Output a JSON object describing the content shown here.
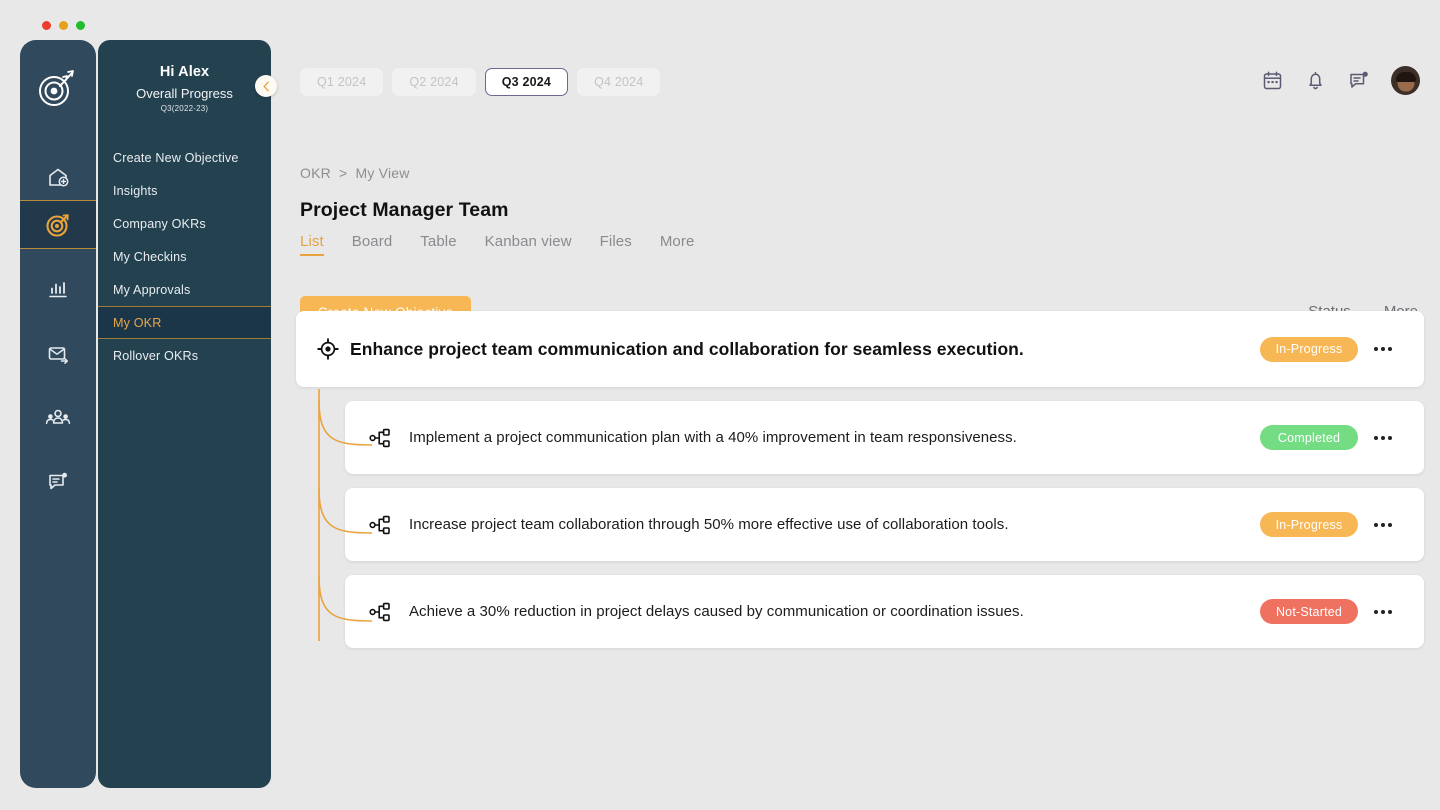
{
  "window": {
    "controls": [
      "close",
      "minimize",
      "maximize"
    ]
  },
  "colors": {
    "rail_bg": "#30495c",
    "nav_bg": "#23414f",
    "accent_orange": "#e8a33d",
    "button_orange": "#f7b755",
    "status_in_progress": "#f7b755",
    "status_completed": "#74dd84",
    "status_not_started": "#ef7261",
    "page_bg": "#e8e8e8"
  },
  "rail": {
    "logo_icon": "target-arrow-logo",
    "items": [
      {
        "icon": "home-add-icon",
        "name": "home",
        "active": false
      },
      {
        "icon": "target-goal-icon",
        "name": "okr",
        "active": true
      },
      {
        "icon": "bar-chart-icon",
        "name": "analytics",
        "active": false
      },
      {
        "icon": "mail-send-icon",
        "name": "messages",
        "active": false
      },
      {
        "icon": "people-group-icon",
        "name": "teams",
        "active": false
      },
      {
        "icon": "feedback-note-icon",
        "name": "feedback",
        "active": false
      }
    ]
  },
  "nav": {
    "greeting": "Hi Alex",
    "subtitle": "Overall Progress",
    "period": "Q3(2022-23)",
    "collapse_icon": "chevron-left-icon",
    "items": [
      {
        "label": "Create New Objective",
        "active": false
      },
      {
        "label": "Insights",
        "active": false
      },
      {
        "label": "Company OKRs",
        "active": false
      },
      {
        "label": "My  Checkins",
        "active": false
      },
      {
        "label": "My Approvals",
        "active": false
      },
      {
        "label": "My OKR",
        "active": true
      },
      {
        "label": "Rollover OKRs",
        "active": false
      }
    ]
  },
  "quarters": [
    {
      "label": "Q1 2024",
      "selected": false
    },
    {
      "label": "Q2 2024",
      "selected": false
    },
    {
      "label": "Q3 2024",
      "selected": true
    },
    {
      "label": "Q4 2024",
      "selected": false
    }
  ],
  "header_icons": [
    {
      "name": "calendar-icon"
    },
    {
      "name": "bell-icon"
    },
    {
      "name": "chat-notification-icon"
    },
    {
      "name": "avatar"
    }
  ],
  "breadcrumb": {
    "root": "OKR",
    "separator": ">",
    "current": "My View"
  },
  "page_title": "Project Manager Team",
  "view_tabs": [
    {
      "label": "List",
      "active": true
    },
    {
      "label": "Board",
      "active": false
    },
    {
      "label": "Table",
      "active": false
    },
    {
      "label": "Kanban view",
      "active": false
    },
    {
      "label": "Files",
      "active": false
    },
    {
      "label": "More",
      "active": false
    }
  ],
  "toolbar": {
    "create_label": "Create New Objective",
    "status_column": "Status",
    "more_column": "More"
  },
  "objective": {
    "icon": "target-crosshair-icon",
    "text": "Enhance project team communication and collaboration for seamless execution.",
    "status": "In-Progress",
    "status_color": "#f7b755",
    "more_icon": "ellipsis-icon"
  },
  "key_results": [
    {
      "icon": "hierarchy-node-icon",
      "text": "Implement a project communication plan with a 40% improvement in team responsiveness.",
      "status": "Completed",
      "status_color": "#74dd84"
    },
    {
      "icon": "hierarchy-node-icon",
      "text": "Increase project team collaboration through 50% more effective use of collaboration tools.",
      "status": "In-Progress",
      "status_color": "#f7b755"
    },
    {
      "icon": "hierarchy-node-icon",
      "text": "Achieve a 30% reduction in project delays caused by communication or coordination issues.",
      "status": "Not-Started",
      "status_color": "#ef7261"
    }
  ]
}
